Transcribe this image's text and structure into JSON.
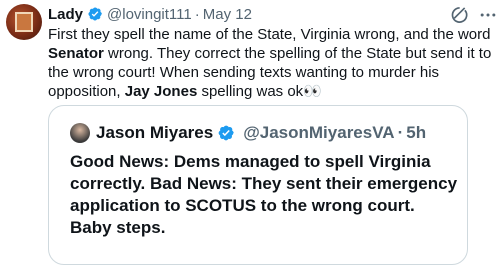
{
  "tweet": {
    "author_name": "Lady",
    "author_handle": "@lovingit111",
    "separator": "·",
    "date": "May 12",
    "text_part1": "First they spell the name of the State, Virginia wrong, and the word ",
    "text_bold1": "Senator",
    "text_part2": " wrong. They correct the spelling of the State but send it to the wrong court! When sending texts wanting to murder his opposition, ",
    "text_bold2": "Jay Jones",
    "text_part3": " spelling was ok",
    "text_emoji": "👀"
  },
  "quoted": {
    "author_name": "Jason Miyares",
    "author_handle": "@JasonMiyaresVA",
    "separator": "·",
    "time": "5h",
    "text": "Good News: Dems managed to spell Virginia correctly.  Bad News:  They sent their emergency  application to SCOTUS to the wrong court.   Baby steps."
  },
  "colors": {
    "verified": "#1d9bf0",
    "secondary_text": "#536471",
    "border": "#cfd9de"
  },
  "icons": [
    "grok-icon",
    "more-icon",
    "verified-badge-icon"
  ]
}
